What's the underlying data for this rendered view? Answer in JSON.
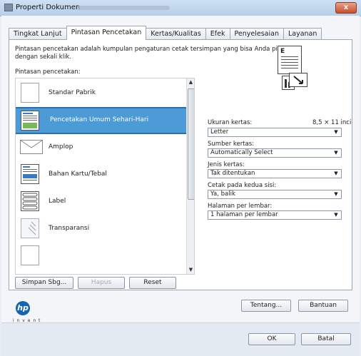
{
  "window": {
    "title": "Properti Dokumen",
    "close_label": "x"
  },
  "tabs": [
    {
      "label": "Tingkat Lanjut",
      "active": false
    },
    {
      "label": "Pintasan Pencetakan",
      "active": true
    },
    {
      "label": "Kertas/Kualitas",
      "active": false
    },
    {
      "label": "Efek",
      "active": false
    },
    {
      "label": "Penyelesaian",
      "active": false
    },
    {
      "label": "Layanan",
      "active": false
    }
  ],
  "panel": {
    "description": "Pintasan pencetakan adalah kumpulan pengaturan cetak tersimpan yang bisa Anda pilih dengan sekali klik.",
    "list_label": "Pintasan pencetakan:",
    "preview_letter": "E"
  },
  "shortcuts": [
    {
      "label": "Standar Pabrik",
      "selected": false
    },
    {
      "label": "Pencetakan Umum Sehari-Hari",
      "selected": true
    },
    {
      "label": "Amplop",
      "selected": false
    },
    {
      "label": "Bahan Kartu/Tebal",
      "selected": false
    },
    {
      "label": "Label",
      "selected": false
    },
    {
      "label": "Transparansi",
      "selected": false
    }
  ],
  "settings": {
    "paper_size_label": "Ukuran kertas:",
    "paper_size_dimensions": "8,5 × 11 inci",
    "paper_size_value": "Letter",
    "paper_source_label": "Sumber kertas:",
    "paper_source_value": "Automatically Select",
    "paper_type_label": "Jenis kertas:",
    "paper_type_value": "Tak ditentukan",
    "duplex_label": "Cetak pada kedua sisi:",
    "duplex_value": "Ya, balik",
    "pages_per_sheet_label": "Halaman per lembar:",
    "pages_per_sheet_value": "1 halaman per lembar"
  },
  "buttons": {
    "save_as": "Simpan Sbg...",
    "delete": "Hapus",
    "reset": "Reset",
    "about": "Tentang...",
    "help": "Bantuan",
    "ok": "OK",
    "cancel": "Batal"
  },
  "logo": {
    "text": "hp",
    "dots": "i n v e n t"
  },
  "colors": {
    "selection": "#4d9bd6",
    "selection_border": "#2a6fae",
    "close_button": "#c94e2a",
    "hp_blue": "#1565b0"
  }
}
